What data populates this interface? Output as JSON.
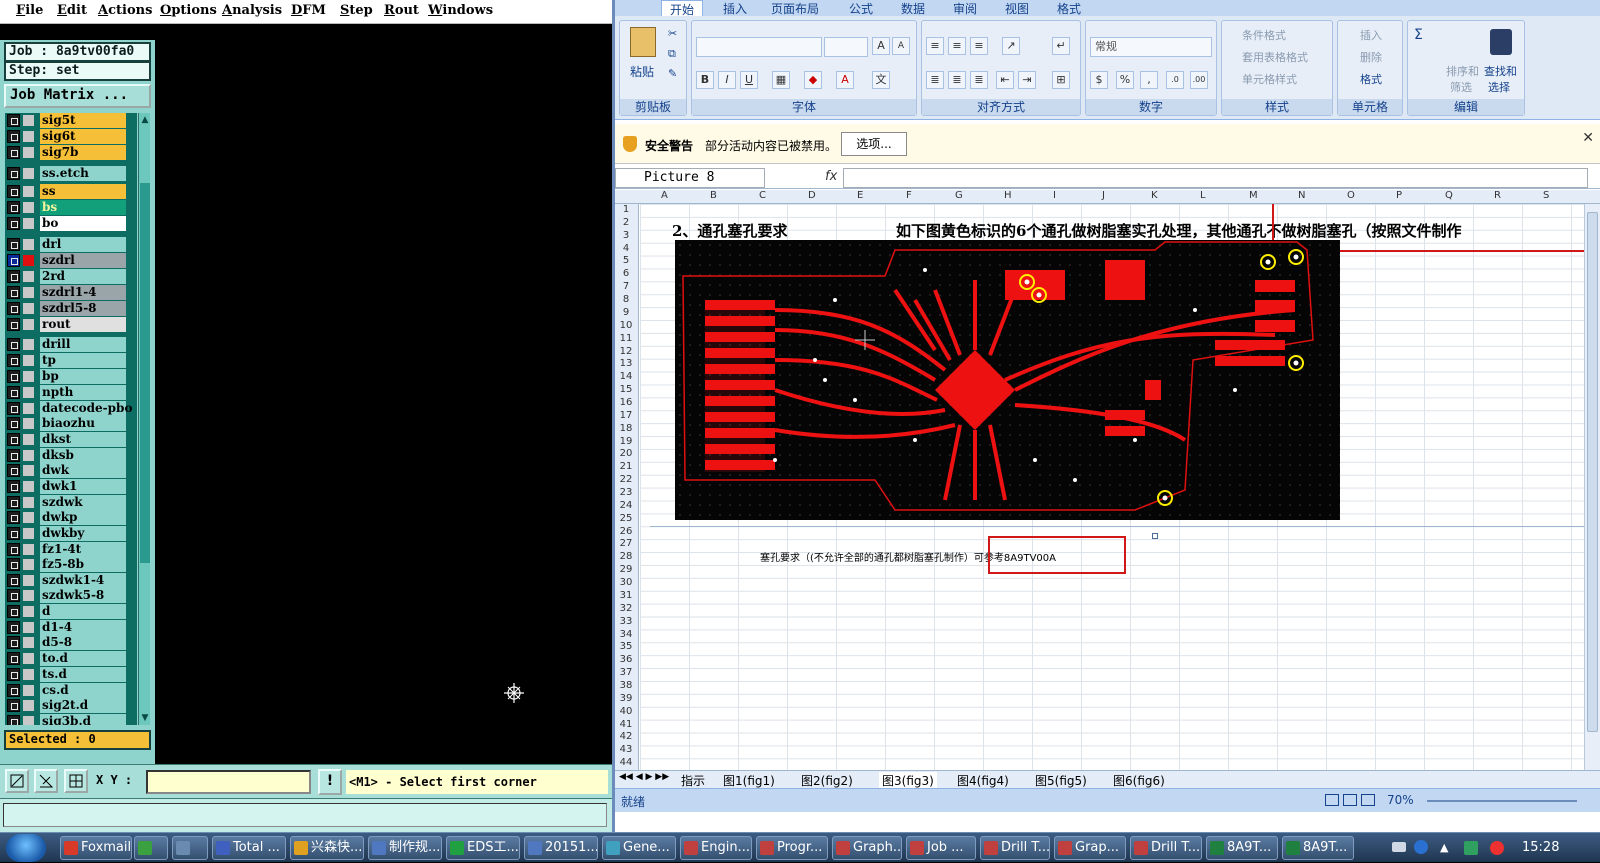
{
  "genesis": {
    "menu": [
      "File",
      "Edit",
      "Actions",
      "Options",
      "Analysis",
      "DFM",
      "Step",
      "Rout",
      "Windows"
    ],
    "job": "Job : 8a9tv00fa0",
    "step": "Step: set",
    "job_matrix": "Job Matrix ...",
    "layers": [
      {
        "name": "sig5t",
        "color": "#f5c038"
      },
      {
        "name": "sig6t",
        "color": "#f5c038"
      },
      {
        "name": "sig7b",
        "color": "#f5c038"
      },
      {
        "name": "ss.etch",
        "color": "#8fd4cc"
      },
      {
        "name": "ss",
        "color": "#f5c038"
      },
      {
        "name": "bs",
        "color": "#12a07a"
      },
      {
        "name": "bo",
        "color": "#ffffff"
      },
      {
        "name": "drl",
        "color": "#8fd4cc"
      },
      {
        "name": "szdrl",
        "color": "#9aa5aa"
      },
      {
        "name": "2rd",
        "color": "#8fd4cc"
      },
      {
        "name": "szdrl1-4",
        "color": "#9aa5aa"
      },
      {
        "name": "szdrl5-8",
        "color": "#9aa5aa"
      },
      {
        "name": "rout",
        "color": "#e0e0e0"
      },
      {
        "name": "drill",
        "color": "#8fd4cc"
      },
      {
        "name": "tp",
        "color": "#8fd4cc"
      },
      {
        "name": "bp",
        "color": "#8fd4cc"
      },
      {
        "name": "npth",
        "color": "#8fd4cc"
      },
      {
        "name": "datecode-pbo",
        "color": "#8fd4cc"
      },
      {
        "name": "biaozhu",
        "color": "#8fd4cc"
      },
      {
        "name": "dkst",
        "color": "#8fd4cc"
      },
      {
        "name": "dksb",
        "color": "#8fd4cc"
      },
      {
        "name": "dwk",
        "color": "#8fd4cc"
      },
      {
        "name": "dwk1",
        "color": "#8fd4cc"
      },
      {
        "name": "szdwk",
        "color": "#8fd4cc"
      },
      {
        "name": "dwkp",
        "color": "#8fd4cc"
      },
      {
        "name": "dwkby",
        "color": "#8fd4cc"
      },
      {
        "name": "fz1-4t",
        "color": "#8fd4cc"
      },
      {
        "name": "fz5-8b",
        "color": "#8fd4cc"
      },
      {
        "name": "szdwk1-4",
        "color": "#8fd4cc"
      },
      {
        "name": "szdwk5-8",
        "color": "#8fd4cc"
      },
      {
        "name": "d",
        "color": "#8fd4cc"
      },
      {
        "name": "d1-4",
        "color": "#8fd4cc"
      },
      {
        "name": "d5-8",
        "color": "#8fd4cc"
      },
      {
        "name": "to.d",
        "color": "#8fd4cc"
      },
      {
        "name": "ts.d",
        "color": "#8fd4cc"
      },
      {
        "name": "cs.d",
        "color": "#8fd4cc"
      },
      {
        "name": "sig2t.d",
        "color": "#8fd4cc"
      },
      {
        "name": "sig3b.d",
        "color": "#8fd4cc"
      }
    ],
    "selected": "Selected : 0",
    "xy_label": "X Y :",
    "prompt_button": "!",
    "prompt": "<M1> - Select first corner"
  },
  "excel": {
    "tabs": [
      "开始",
      "插入",
      "页面布局",
      "公式",
      "数据",
      "审阅",
      "视图",
      "格式"
    ],
    "ribbon": {
      "paste": "粘贴",
      "clipboard": "剪贴板",
      "font_group": "字体",
      "align_group": "对齐方式",
      "number_group": "数字",
      "number_format": "常规",
      "styles_group": "样式",
      "cells_group": "单元格",
      "edit_group": "编辑",
      "cond_format": "条件格式",
      "table_format": "套用表格格式",
      "cell_style": "单元格样式",
      "insert": "插入",
      "delete": "删除",
      "format": "格式",
      "sort_filter_1": "排序和",
      "sort_filter_2": "筛选",
      "find_select_1": "查找和",
      "find_select_2": "选择",
      "bold": "B",
      "italic": "I",
      "underline": "U",
      "percent": "%",
      "comma": ","
    },
    "security": {
      "title": "安全警告",
      "message": "部分活动内容已被禁用。",
      "button": "选项..."
    },
    "name_box": "Picture 8",
    "fx": "fx",
    "columns": [
      "A",
      "B",
      "C",
      "D",
      "E",
      "F",
      "G",
      "H",
      "I",
      "J",
      "K",
      "L",
      "M",
      "N",
      "O",
      "P",
      "Q",
      "R",
      "S"
    ],
    "rows_first": 1,
    "rows_last": 44,
    "row2_left": "2、通孔塞孔要求",
    "row2_right": "如下图黄色标识的6个通孔做树脂塞实孔处理，其他通孔不做树脂塞孔（按照文件制作",
    "row28": "塞孔要求（(不允许全部的通孔都树脂塞孔制作）可参考8A9TV00A",
    "sheet_tabs": [
      "指示",
      "图1(fig1)",
      "图2(fig2)",
      "图3(fig3)",
      "图4(fig4)",
      "图5(fig5)",
      "图6(fig6)"
    ],
    "status": "就绪",
    "zoom": "70%"
  },
  "taskbar": {
    "items": [
      {
        "label": "Foxmail",
        "color": "#d83a2a"
      },
      {
        "label": "",
        "color": "#3aa040"
      },
      {
        "label": "",
        "color": "#6a8ab0"
      },
      {
        "label": "Total ...",
        "color": "#4060c0"
      },
      {
        "label": "兴森快...",
        "color": "#e0a020"
      },
      {
        "label": "制作规...",
        "color": "#5078c0"
      },
      {
        "label": "EDS工...",
        "color": "#20a040"
      },
      {
        "label": "20151...",
        "color": "#5078c0"
      },
      {
        "label": "Gene...",
        "color": "#40a0c0"
      },
      {
        "label": "Engin...",
        "color": "#c04040"
      },
      {
        "label": "Progr...",
        "color": "#c04040"
      },
      {
        "label": "Graph...",
        "color": "#c04040"
      },
      {
        "label": "Job ...",
        "color": "#c04040"
      },
      {
        "label": "Drill T...",
        "color": "#c04040"
      },
      {
        "label": "Grap...",
        "color": "#c04040"
      },
      {
        "label": "Drill T...",
        "color": "#c04040"
      },
      {
        "label": "8A9T...",
        "color": "#208040"
      },
      {
        "label": "8A9T...",
        "color": "#208040"
      }
    ],
    "clock": "15:28"
  }
}
